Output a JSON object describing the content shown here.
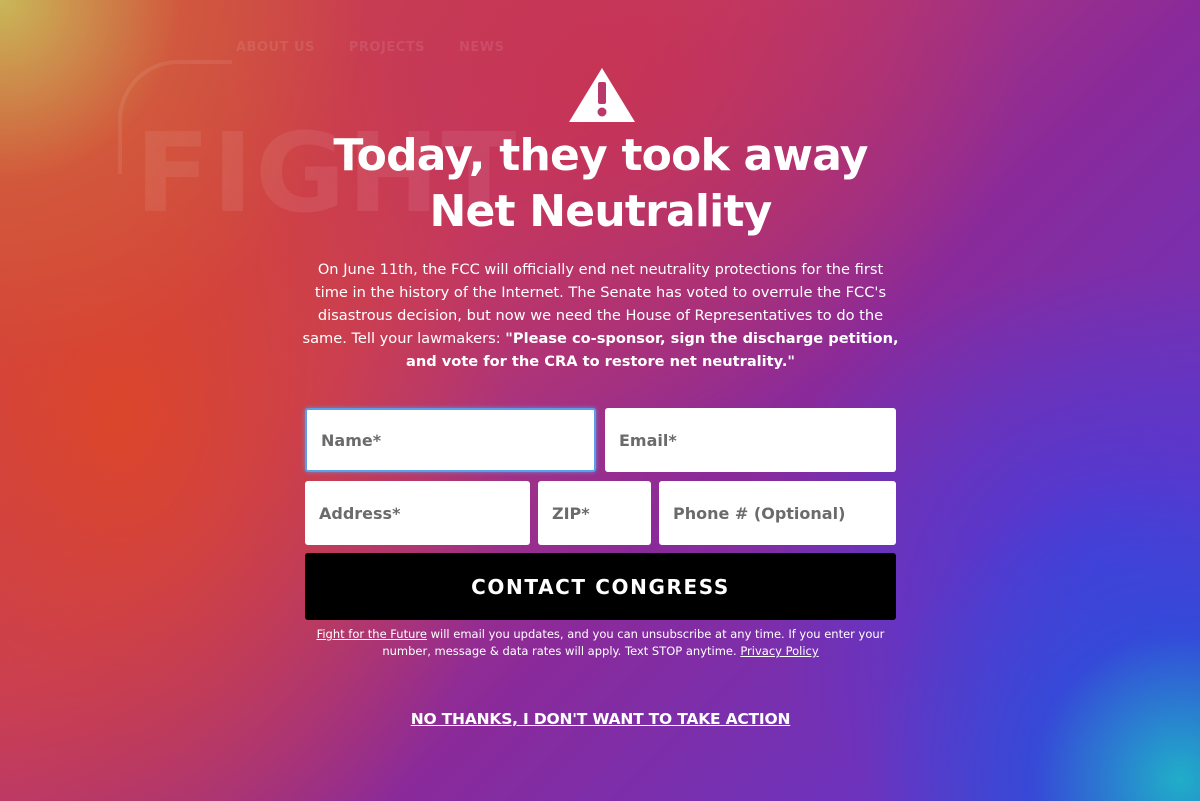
{
  "background_nav": {
    "items": [
      "ABOUT US",
      "PROJECTS",
      "NEWS"
    ],
    "big_text": "FIGHT"
  },
  "modal": {
    "icon": "warning-triangle-icon",
    "headline": "Today, they took away Net Neutrality",
    "body_plain": "On June 11th, the FCC will officially end net neutrality protections for the first time in the history of the Internet. The Senate has voted to overrule the FCC's disastrous decision, but now we need the House of Representatives to do the same. Tell your lawmakers: ",
    "body_bold": "\"Please co-sponsor, sign the discharge petition, and vote for the CRA to restore net neutrality.\""
  },
  "form": {
    "name_placeholder": "Name*",
    "email_placeholder": "Email*",
    "address_placeholder": "Address*",
    "zip_placeholder": "ZIP*",
    "phone_placeholder": "Phone # (Optional)",
    "submit_label": "CONTACT CONGRESS"
  },
  "disclaimer": {
    "org_link": "Fight for the Future",
    "text": " will email you updates, and you can unsubscribe at any time. If you enter your number, message & data rates will apply. Text STOP anytime. ",
    "privacy_link": "Privacy Policy"
  },
  "decline_link": "NO THANKS, I DON'T WANT TO TAKE ACTION",
  "colors": {
    "submit_bg": "#000000",
    "focus_ring": "#5aa0e8",
    "gradient_left": "#d04a3a",
    "gradient_mid": "#8a2a9a",
    "gradient_right": "#4a40d0"
  }
}
